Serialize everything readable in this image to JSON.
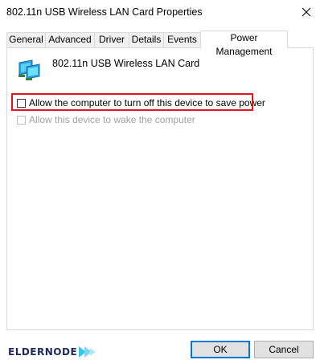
{
  "window": {
    "title": "802.11n USB Wireless LAN Card Properties",
    "close_icon": "close-icon"
  },
  "tabs": [
    {
      "label": "General",
      "active": false
    },
    {
      "label": "Advanced",
      "active": false
    },
    {
      "label": "Driver",
      "active": false
    },
    {
      "label": "Details",
      "active": false
    },
    {
      "label": "Events",
      "active": false
    },
    {
      "label": "Power Management",
      "active": true
    }
  ],
  "device": {
    "icon": "network-adapter-icon",
    "name": "802.11n USB Wireless LAN Card"
  },
  "options": [
    {
      "label": "Allow the computer to turn off this device to save power",
      "checked": false,
      "enabled": true,
      "highlighted": true
    },
    {
      "label": "Allow this device to wake the computer",
      "checked": false,
      "enabled": false
    }
  ],
  "buttons": {
    "ok": "OK",
    "cancel": "Cancel"
  },
  "watermark": {
    "text": "ELDERNODE"
  },
  "colors": {
    "highlight": "#e0141e",
    "default_button_border": "#0078d7",
    "logo_arrow": "#3fc4e6"
  }
}
